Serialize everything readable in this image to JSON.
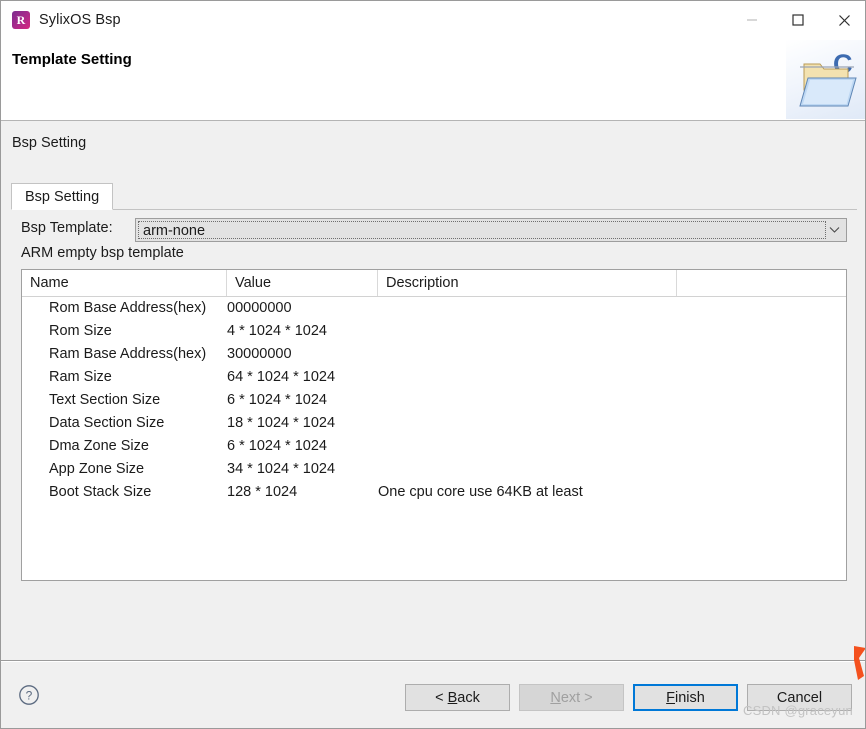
{
  "window": {
    "title": "SylixOS Bsp",
    "app_icon_letter": "R",
    "controls": {
      "minimize": "minimize-icon",
      "maximize": "maximize-icon",
      "close": "close-icon"
    }
  },
  "header": {
    "page_title": "Template Setting",
    "banner_icon": "open-folder-with-c-icon"
  },
  "body": {
    "section_title": "Bsp Setting",
    "tab": {
      "label": "Bsp Setting"
    },
    "template": {
      "label": "Bsp Template:",
      "value": "arm-none",
      "arrow_icon": "chevron-down-icon",
      "description": "ARM empty bsp template"
    },
    "table": {
      "columns": [
        "Name",
        "Value",
        "Description",
        ""
      ],
      "rows": [
        {
          "name": "Rom Base Address(hex)",
          "value": "00000000",
          "description": ""
        },
        {
          "name": "Rom Size",
          "value": "4 * 1024 * 1024",
          "description": ""
        },
        {
          "name": "Ram Base Address(hex)",
          "value": "30000000",
          "description": ""
        },
        {
          "name": "Ram Size",
          "value": "64 * 1024 * 1024",
          "description": ""
        },
        {
          "name": "Text Section Size",
          "value": "6 * 1024 * 1024",
          "description": ""
        },
        {
          "name": "Data Section Size",
          "value": "18 * 1024 * 1024",
          "description": ""
        },
        {
          "name": "Dma Zone Size",
          "value": "6 * 1024 * 1024",
          "description": ""
        },
        {
          "name": "App Zone Size",
          "value": "34 * 1024 * 1024",
          "description": ""
        },
        {
          "name": "Boot Stack Size",
          "value": "128 * 1024",
          "description": "One cpu core use 64KB at least"
        }
      ]
    }
  },
  "footer": {
    "help_icon": "help-question-icon",
    "buttons": {
      "back": {
        "label": "< Back",
        "mnemonic": "B",
        "enabled": true,
        "default": false
      },
      "next": {
        "label": "Next >",
        "mnemonic": "N",
        "enabled": false,
        "default": false
      },
      "finish": {
        "label": "Finish",
        "mnemonic": "F",
        "enabled": true,
        "default": true
      },
      "cancel": {
        "label": "Cancel",
        "mnemonic": "",
        "enabled": true,
        "default": false
      }
    }
  },
  "watermark": "CSDN @graceyun",
  "colors": {
    "accent": "#0078d7",
    "body_bg": "#f0f0f0",
    "table_bg": "#ffffff",
    "icon_gradient_start": "#7b2d8e",
    "icon_gradient_end": "#d6277f",
    "cursor_orange": "#f4511e"
  }
}
